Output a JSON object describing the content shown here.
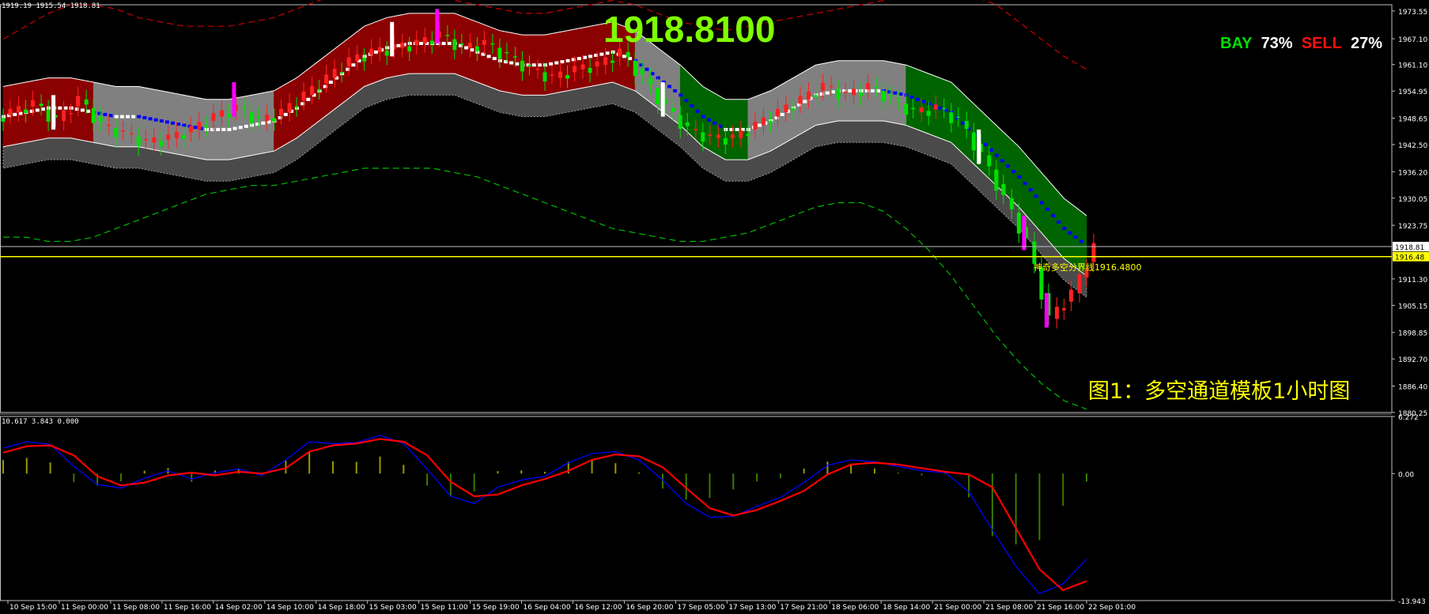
{
  "header": {
    "ohlc_readout": "1919.19 1915.54 1918.81",
    "big_price": "1918.8100",
    "bay_label": "BAY",
    "bay_pct": "73%",
    "sell_label": "SELL",
    "sell_pct": "27%",
    "caption": "图1：多空通道模板1小时图",
    "boundary_line_label": "神奇多空分界线1916.4800",
    "macd_readout": "10.617 3.843 0.000"
  },
  "colors": {
    "bull_candle": "#ff2020",
    "bear_candle": "#00e000",
    "bull_band": "#8b0000",
    "bear_band": "#006400",
    "neutral_band": "#808080",
    "shadow_band": "#4a4a4a",
    "signal_up": "#ffffff",
    "signal_down": "#0000ff",
    "signal_extreme": "#ff00ff",
    "macd_line": "#0000ff",
    "signal_line": "#ff0000",
    "histogram": "#999900",
    "price_line": "#ffff00"
  },
  "chart_data": [
    {
      "type": "candlestick",
      "title": "",
      "ylim": [
        1880.25,
        1975.0
      ],
      "y_ticks": [
        "1973.55",
        "1967.10",
        "1961.10",
        "1954.95",
        "1948.65",
        "1942.50",
        "1936.20",
        "1930.05",
        "1923.75",
        "1918.81",
        "1916.48",
        "1911.30",
        "1905.15",
        "1898.85",
        "1892.70",
        "1886.40",
        "1880.25"
      ],
      "current_price": 1918.81,
      "boundary_price": 1916.48,
      "x_labels": [
        "10 Sep 15:00",
        "11 Sep 00:00",
        "11 Sep 08:00",
        "11 Sep 16:00",
        "14 Sep 02:00",
        "14 Sep 10:00",
        "14 Sep 18:00",
        "15 Sep 03:00",
        "15 Sep 11:00",
        "15 Sep 19:00",
        "16 Sep 04:00",
        "16 Sep 12:00",
        "16 Sep 20:00",
        "17 Sep 05:00",
        "17 Sep 13:00",
        "17 Sep 21:00",
        "18 Sep 06:00",
        "18 Sep 14:00",
        "21 Sep 00:00",
        "21 Sep 08:00",
        "21 Sep 16:00",
        "22 Sep 01:00"
      ],
      "band_mid": [
        1949,
        1950,
        1951,
        1951,
        1950,
        1949,
        1949,
        1948,
        1947,
        1946,
        1946,
        1947,
        1948,
        1951,
        1955,
        1959,
        1963,
        1965,
        1966,
        1966,
        1966,
        1964,
        1962,
        1961,
        1961,
        1962,
        1963,
        1964,
        1962,
        1958,
        1954,
        1949,
        1946,
        1946,
        1948,
        1951,
        1954,
        1955,
        1955,
        1955,
        1954,
        1952,
        1950,
        1945,
        1940,
        1935,
        1929,
        1923,
        1919
      ],
      "band_half_width": 7,
      "band_phases": [
        "bull",
        "bull",
        "bull",
        "bull",
        "neutral",
        "neutral",
        "neutral",
        "neutral",
        "neutral",
        "neutral",
        "neutral",
        "neutral",
        "bull",
        "bull",
        "bull",
        "bull",
        "bull",
        "bull",
        "bull",
        "bull",
        "bull",
        "bull",
        "bull",
        "bull",
        "bull",
        "bull",
        "bull",
        "bull",
        "neutral",
        "neutral",
        "bear",
        "bear",
        "bear",
        "neutral",
        "neutral",
        "neutral",
        "neutral",
        "neutral",
        "neutral",
        "neutral",
        "bear",
        "bear",
        "bear",
        "bear",
        "bear",
        "bear",
        "bear",
        "bear",
        "bear"
      ],
      "upper_outer": [
        1967,
        1970,
        1973,
        1975,
        1975,
        1974,
        1972,
        1971,
        1970,
        1970,
        1970,
        1971,
        1972,
        1974,
        1976,
        1978,
        1980,
        1980,
        1979,
        1978,
        1976,
        1975,
        1974,
        1973,
        1973,
        1974,
        1975,
        1976,
        1975,
        1973,
        1971,
        1970,
        1969,
        1970,
        1971,
        1972,
        1973,
        1974,
        1975,
        1976,
        1977,
        1978,
        1978,
        1977,
        1975,
        1971,
        1967,
        1963,
        1960
      ],
      "lower_outer": [
        1921,
        1921,
        1920,
        1920,
        1921,
        1923,
        1925,
        1927,
        1929,
        1931,
        1932,
        1933,
        1933,
        1934,
        1935,
        1936,
        1937,
        1937,
        1937,
        1937,
        1936,
        1935,
        1933,
        1931,
        1929,
        1927,
        1925,
        1923,
        1922,
        1921,
        1920,
        1920,
        1921,
        1922,
        1924,
        1926,
        1928,
        1929,
        1929,
        1927,
        1923,
        1918,
        1912,
        1905,
        1898,
        1892,
        1887,
        1883,
        1881
      ],
      "candles_close": [
        1950,
        1952,
        1948,
        1953,
        1947,
        1945,
        1943,
        1944,
        1946,
        1949,
        1951,
        1948,
        1950,
        1954,
        1958,
        1962,
        1964,
        1965,
        1966,
        1968,
        1965,
        1966,
        1963,
        1960,
        1958,
        1960,
        1961,
        1964,
        1958,
        1951,
        1946,
        1944,
        1944,
        1947,
        1950,
        1953,
        1956,
        1954,
        1956,
        1953,
        1950,
        1951,
        1948,
        1940,
        1930,
        1920,
        1902,
        1908,
        1918.81
      ],
      "extra_candles": [
        {
          "open": 1950,
          "close": 1955,
          "high": 1960,
          "low": 1946
        },
        {
          "open": 1958,
          "close": 1962,
          "high": 1969,
          "low": 1954
        }
      ]
    },
    {
      "type": "macd",
      "title": "",
      "ylim": [
        -13.943,
        6.272
      ],
      "y_ticks": [
        "6.272",
        "0.00",
        "-13.943"
      ],
      "macd": [
        2.8,
        3.5,
        3.2,
        0.8,
        -1.2,
        -1.6,
        -0.5,
        0.3,
        -0.6,
        0.1,
        0.5,
        -0.2,
        1.5,
        3.5,
        3.3,
        3.4,
        4.2,
        3.3,
        0.5,
        -2.5,
        -3.3,
        -1.5,
        -0.7,
        -0.3,
        1.2,
        2.2,
        2.4,
        1.5,
        -0.7,
        -3.3,
        -4.8,
        -4.7,
        -3.6,
        -2.6,
        -1.0,
        0.9,
        1.5,
        1.3,
        0.8,
        0.3,
        0.1,
        -2.0,
        -6.2,
        -10.2,
        -13.2,
        -12.1,
        -9.4
      ],
      "signal": [
        2.3,
        3.0,
        3.1,
        2.0,
        -0.3,
        -1.3,
        -1.0,
        -0.2,
        0.1,
        -0.2,
        0.2,
        0.0,
        0.6,
        2.4,
        3.1,
        3.3,
        3.8,
        3.5,
        2.0,
        -0.9,
        -2.5,
        -2.3,
        -1.3,
        -0.6,
        0.3,
        1.5,
        2.1,
        1.9,
        0.7,
        -1.6,
        -3.8,
        -4.6,
        -4.0,
        -3.0,
        -1.9,
        -0.1,
        1.0,
        1.2,
        1.0,
        0.6,
        0.2,
        -0.1,
        -1.5,
        -6.0,
        -10.5,
        -12.8,
        -11.8
      ]
    }
  ]
}
